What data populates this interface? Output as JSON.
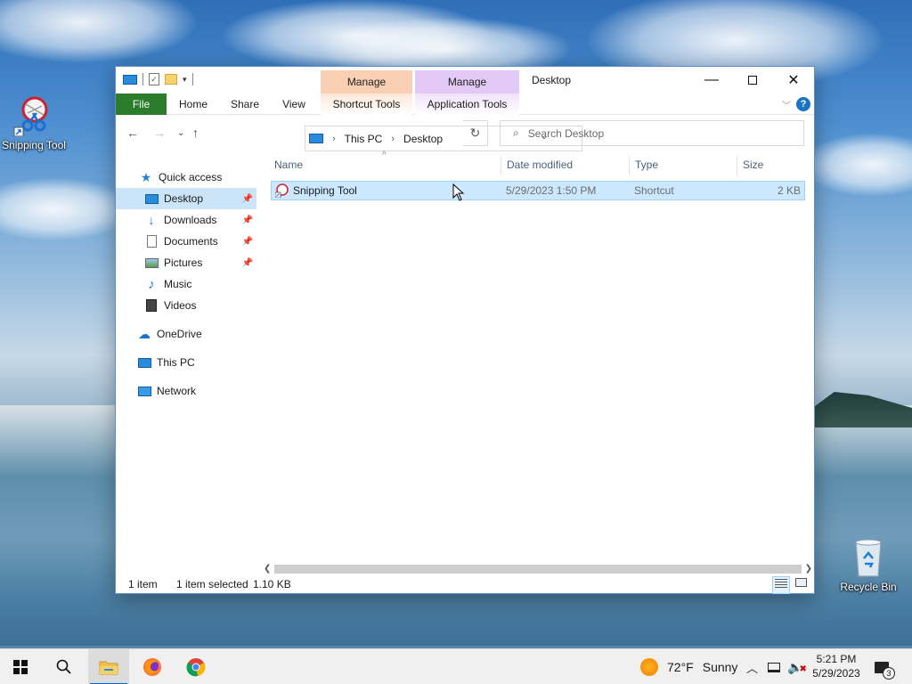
{
  "desktop": {
    "icons": [
      {
        "label": "Snipping Tool",
        "icon": "snipping-tool-icon"
      },
      {
        "label": "Recycle Bin",
        "icon": "recycle-bin-icon"
      }
    ]
  },
  "window": {
    "title": "Desktop",
    "context_tabs": {
      "manage1": "Manage",
      "manage2": "Manage",
      "shortcut_tools": "Shortcut Tools",
      "application_tools": "Application Tools"
    },
    "ribbon_tabs": [
      "File",
      "Home",
      "Share",
      "View"
    ],
    "address": {
      "root": "This PC",
      "current": "Desktop"
    },
    "search_placeholder": "Search Desktop",
    "nav": {
      "quick_access": "Quick access",
      "items": [
        {
          "label": "Desktop",
          "icon": "desktop-folder-icon",
          "pinned": true,
          "selected": true
        },
        {
          "label": "Downloads",
          "icon": "downloads-icon",
          "pinned": true
        },
        {
          "label": "Documents",
          "icon": "documents-icon",
          "pinned": true
        },
        {
          "label": "Pictures",
          "icon": "pictures-icon",
          "pinned": true
        },
        {
          "label": "Music",
          "icon": "music-icon"
        },
        {
          "label": "Videos",
          "icon": "videos-icon"
        }
      ],
      "onedrive": "OneDrive",
      "this_pc": "This PC",
      "network": "Network"
    },
    "columns": [
      "Name",
      "Date modified",
      "Type",
      "Size"
    ],
    "files": [
      {
        "name": "Snipping Tool",
        "date": "5/29/2023 1:50 PM",
        "type": "Shortcut",
        "size": "2 KB"
      }
    ],
    "status": {
      "count": "1 item",
      "selected": "1 item selected",
      "size": "1.10 KB"
    }
  },
  "taskbar": {
    "apps": [
      "start-icon",
      "search-icon",
      "file-explorer-icon",
      "firefox-icon",
      "chrome-icon"
    ],
    "weather": {
      "temp": "72°F",
      "condition": "Sunny"
    },
    "time": "5:21 PM",
    "date": "5/29/2023",
    "notifications": "3"
  },
  "colors": {
    "accent": "#0a64c8",
    "file_tab": "#2b7d2b",
    "selection": "#cce8ff"
  }
}
